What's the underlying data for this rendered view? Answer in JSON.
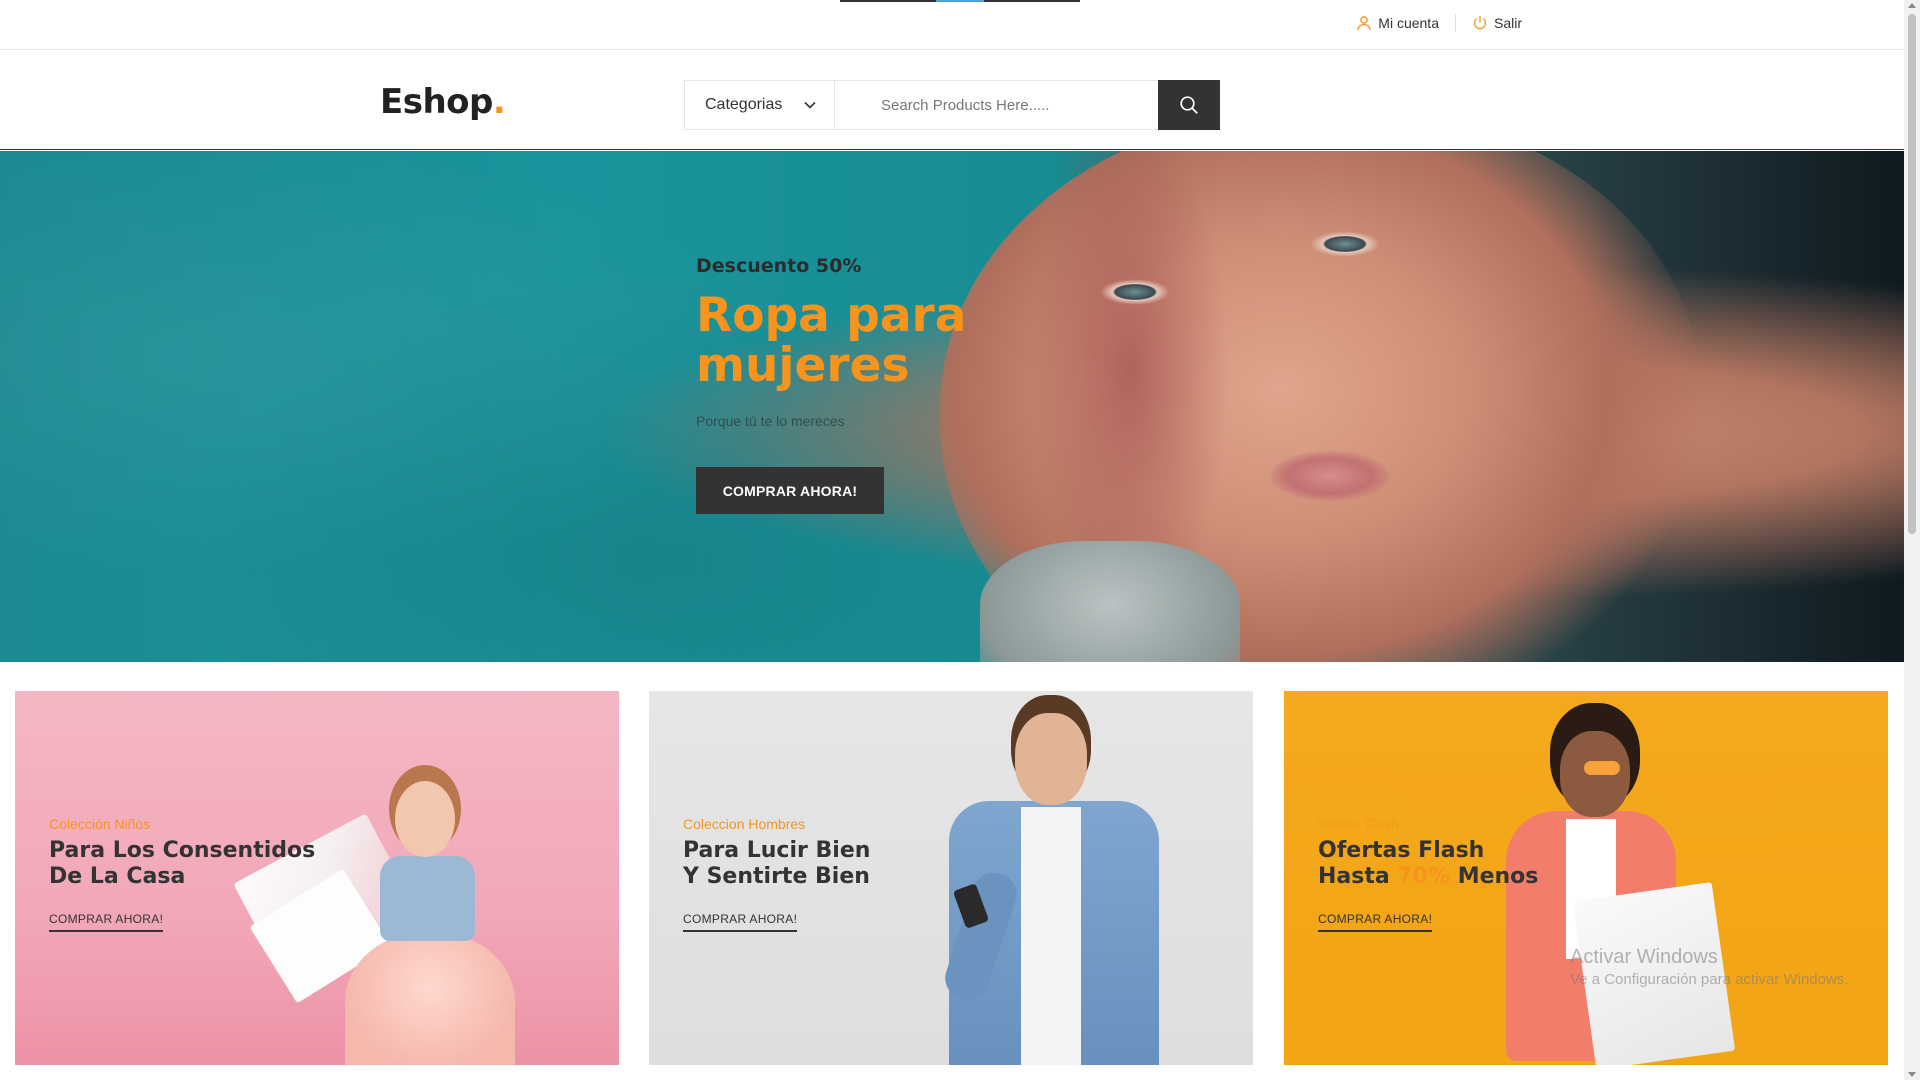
{
  "topbar": {
    "account_label": "Mi cuenta",
    "logout_label": "Salir",
    "icons": {
      "account": "user-icon",
      "logout": "power-icon"
    }
  },
  "header": {
    "logo_text": "Eshop",
    "logo_dot": ".",
    "category_select": "Categorias",
    "search_placeholder": "Search Products Here.....",
    "search_button_icon": "search-icon"
  },
  "hero": {
    "kicker": "Descuento 50%",
    "title": "Ropa para mujeres",
    "subtitle": "Porque tú te lo mereces",
    "cta": "COMPRAR AHORA!"
  },
  "banners": [
    {
      "kicker": "Colección Niños",
      "title_line1": "Para Los Consentidos",
      "title_line2": "De La Casa",
      "cta": "COMPRAR AHORA!"
    },
    {
      "kicker": "Coleccion Hombres",
      "title_line1": "Para Lucir Bien",
      "title_line2": "Y Sentirte Bien",
      "cta": "COMPRAR AHORA!"
    },
    {
      "kicker": "Ventas Flash",
      "title_line1": "Ofertas Flash",
      "title_line2_pre": "Hasta ",
      "title_line2_hl": "70%",
      "title_line2_post": " Menos",
      "cta": "COMPRAR AHORA!"
    }
  ],
  "os_overlay": {
    "line1": "Activar Windows",
    "line2": "Ve a Configuración para activar Windows."
  },
  "colors": {
    "accent": "#f7941d",
    "dark": "#333333",
    "hero_teal": "#1a949c"
  }
}
